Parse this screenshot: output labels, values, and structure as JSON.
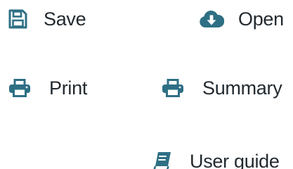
{
  "actions": {
    "save": {
      "label": "Save",
      "icon": "floppy-disk-icon"
    },
    "open": {
      "label": "Open",
      "icon": "cloud-download-icon"
    },
    "print": {
      "label": "Print",
      "icon": "printer-icon"
    },
    "summary": {
      "label": "Summary",
      "icon": "printer-icon"
    },
    "user_guide": {
      "label": "User guide",
      "icon": "book-icon"
    }
  },
  "colors": {
    "icon": "#2e6f84",
    "text": "#222a30",
    "background": "#ffffff"
  }
}
